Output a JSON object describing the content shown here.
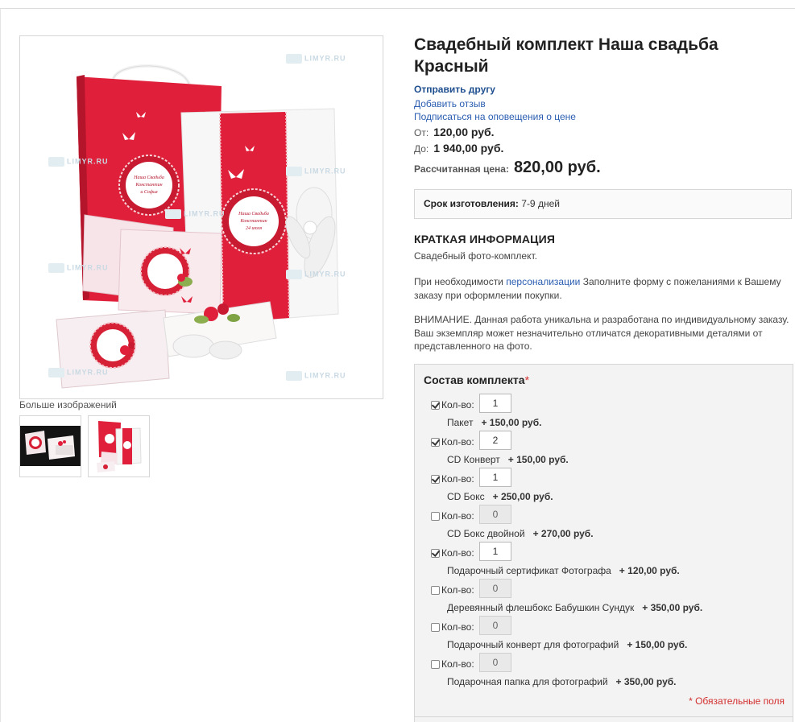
{
  "product": {
    "title_line1": "Свадебный комплект Наша свадьба",
    "title_line2": "Красный"
  },
  "links": {
    "send_friend": "Отправить другу",
    "add_review": "Добавить отзыв",
    "subscribe": "Подписаться на оповещения о цене"
  },
  "price": {
    "from_label": "От:",
    "from_value": "120,00 руб.",
    "to_label": "До:",
    "to_value": "1 940,00 руб.",
    "calc_label": "Рассчитанная цена:",
    "calc_value": "820,00 руб."
  },
  "term": {
    "label": "Срок изготовления:",
    "value": "7-9 дней"
  },
  "info": {
    "heading": "КРАТКАЯ ИНФОРМАЦИЯ",
    "desc": "Свадебный фото-комплект.",
    "p2_before": "При необходимости ",
    "p2_link": "персонализации",
    "p2_after": " Заполните форму с пожеланиями к Вашему заказу при оформлении покупки.",
    "p3": "ВНИМАНИЕ. Данная работа уникальна и разработана по индивидуальному заказу. Ваш экземпляр может незначительно отличатся декоративными деталями от представленного на фото."
  },
  "gallery": {
    "more_label": "Больше изображений",
    "watermark": "LIMYR.RU",
    "card_text": [
      "Наша Свадьба",
      "Константин",
      "и Софья",
      "24 июля",
      "2014 года"
    ]
  },
  "kit": {
    "title": "Состав комплекта",
    "required_mark": "*",
    "qty_label": "Кол-во:",
    "required_note": "* Обязательные поля",
    "items": [
      {
        "name": "Пакет",
        "price": "+ 150,00 руб.",
        "qty": "1",
        "checked": true
      },
      {
        "name": "CD Конверт",
        "price": "+ 150,00 руб.",
        "qty": "2",
        "checked": true
      },
      {
        "name": "CD Бокс",
        "price": "+ 250,00 руб.",
        "qty": "1",
        "checked": true
      },
      {
        "name": "CD Бокс двойной",
        "price": "+ 270,00 руб.",
        "qty": "0",
        "checked": false
      },
      {
        "name": "Подарочный сертификат Фотографа",
        "price": "+ 120,00 руб.",
        "qty": "1",
        "checked": true
      },
      {
        "name": "Деревянный флешбокс Бабушкин Сундук",
        "price": "+ 350,00 руб.",
        "qty": "0",
        "checked": false
      },
      {
        "name": "Подарочный конверт для фотографий",
        "price": "+ 150,00 руб.",
        "qty": "0",
        "checked": false
      },
      {
        "name": "Подарочная папка для фотографий",
        "price": "+ 350,00 руб.",
        "qty": "0",
        "checked": false
      }
    ]
  },
  "colors": {
    "accent_red": "#e0203a",
    "link_blue": "#2a5db0"
  }
}
